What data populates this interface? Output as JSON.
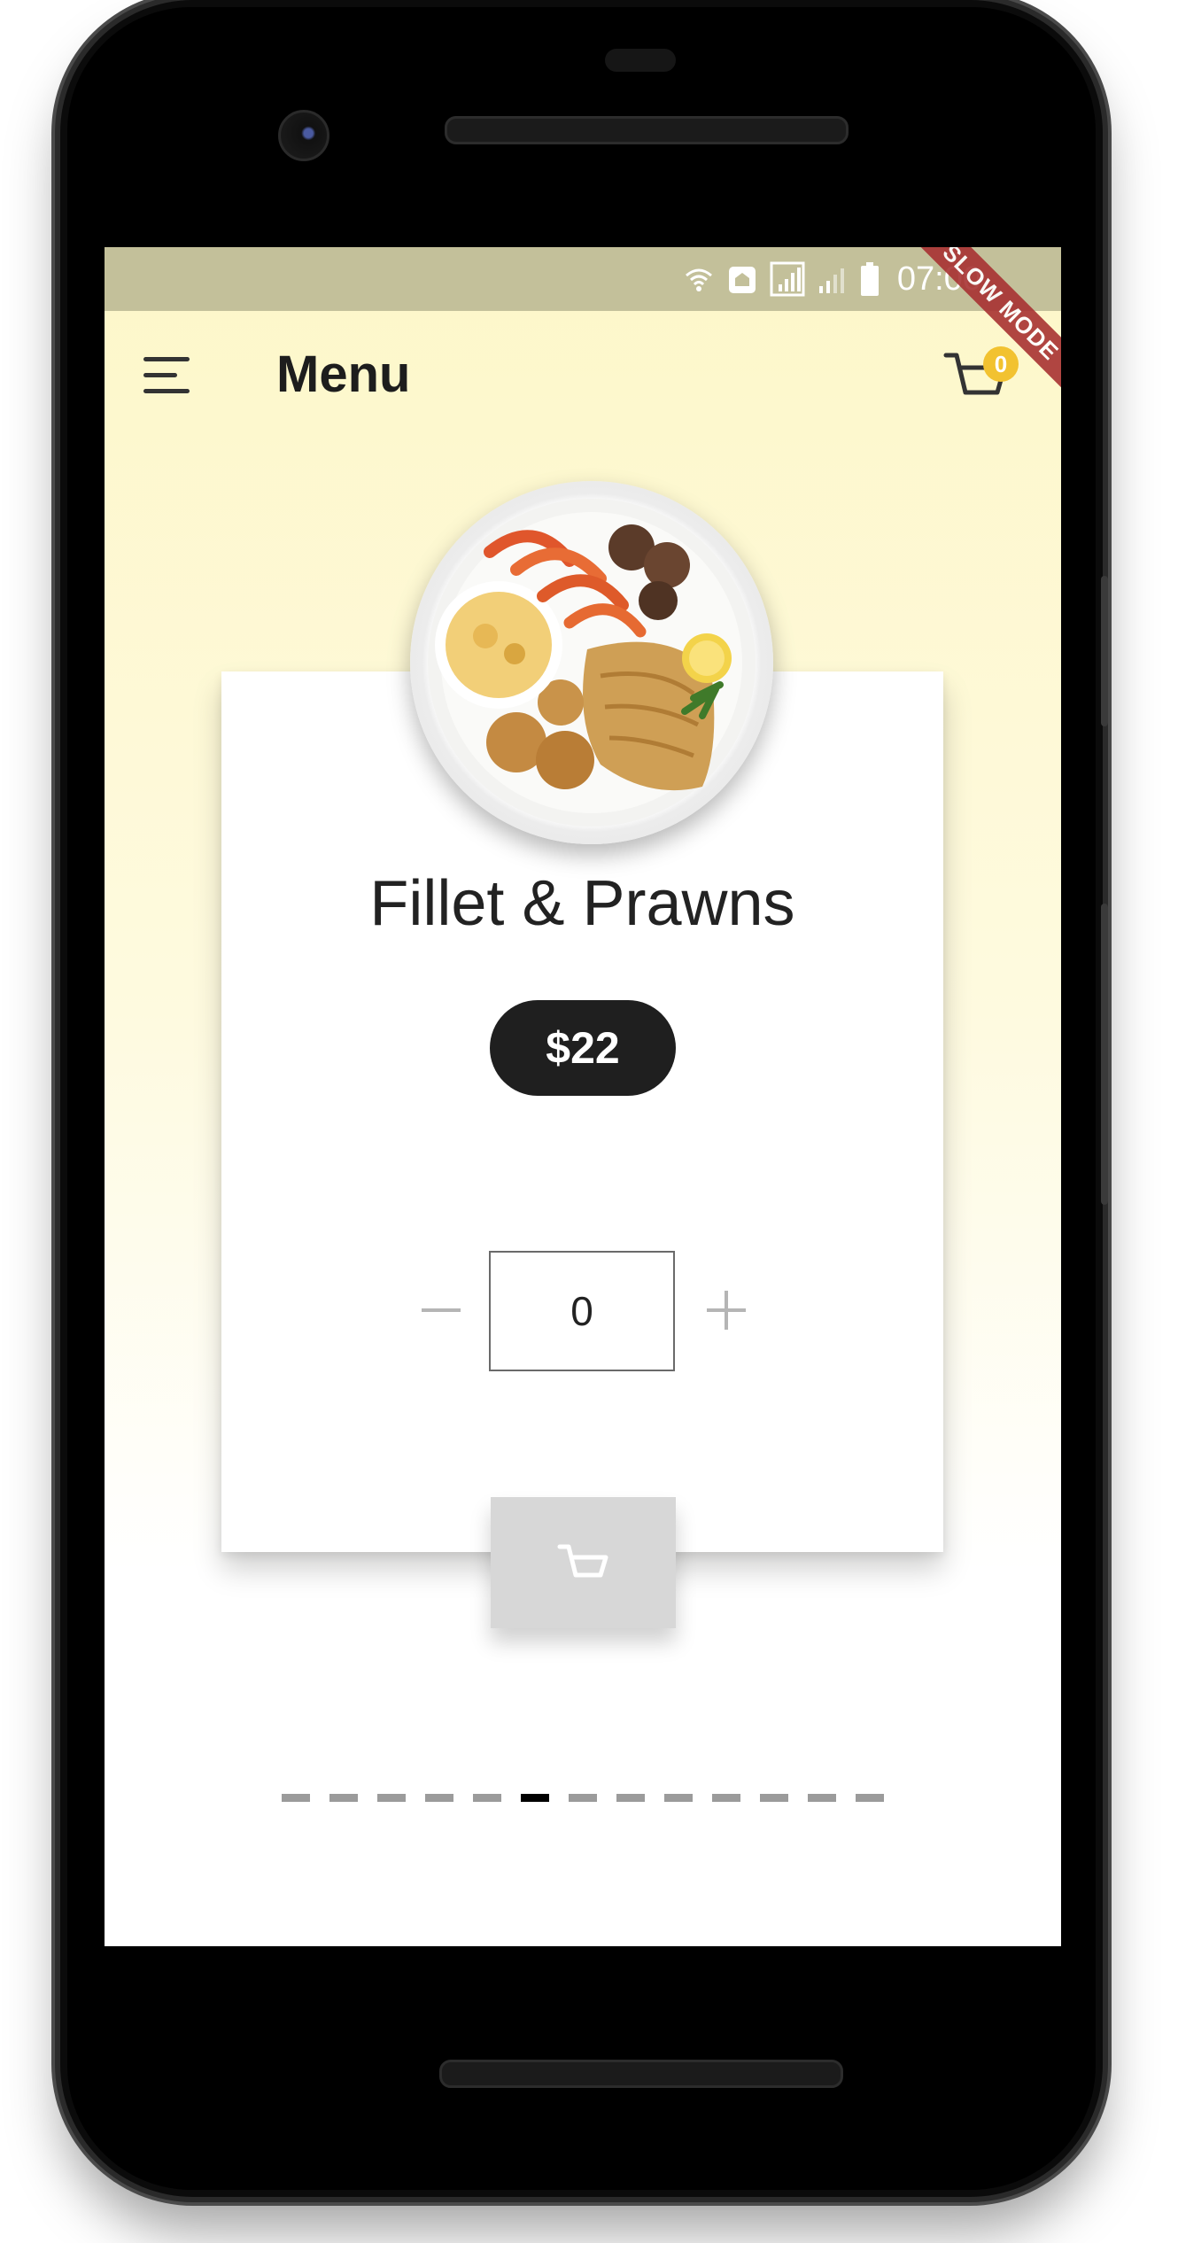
{
  "status_bar": {
    "time": "07:00",
    "icons": [
      "wifi-icon",
      "home-notification-icon",
      "signal-icon",
      "signal-weak-icon",
      "battery-icon"
    ],
    "ribbon": "SLOW MODE"
  },
  "app_bar": {
    "title": "Menu",
    "cart_count": "0"
  },
  "product": {
    "name": "Fillet & Prawns",
    "price": "$22",
    "quantity": "0",
    "image": "seafood-plate-image"
  },
  "quantity_controls": {
    "minus_icon": "minus-icon",
    "plus_icon": "plus-icon"
  },
  "pager": {
    "page_count": 13,
    "active_index": 5
  },
  "colors": {
    "status_bar": "#c3c09a",
    "background_top": "#fdf7c9",
    "price_pill": "#1f1f1f",
    "badge": "#f2c230",
    "add_button": "#d7d7d7",
    "ribbon": "#a83232"
  }
}
